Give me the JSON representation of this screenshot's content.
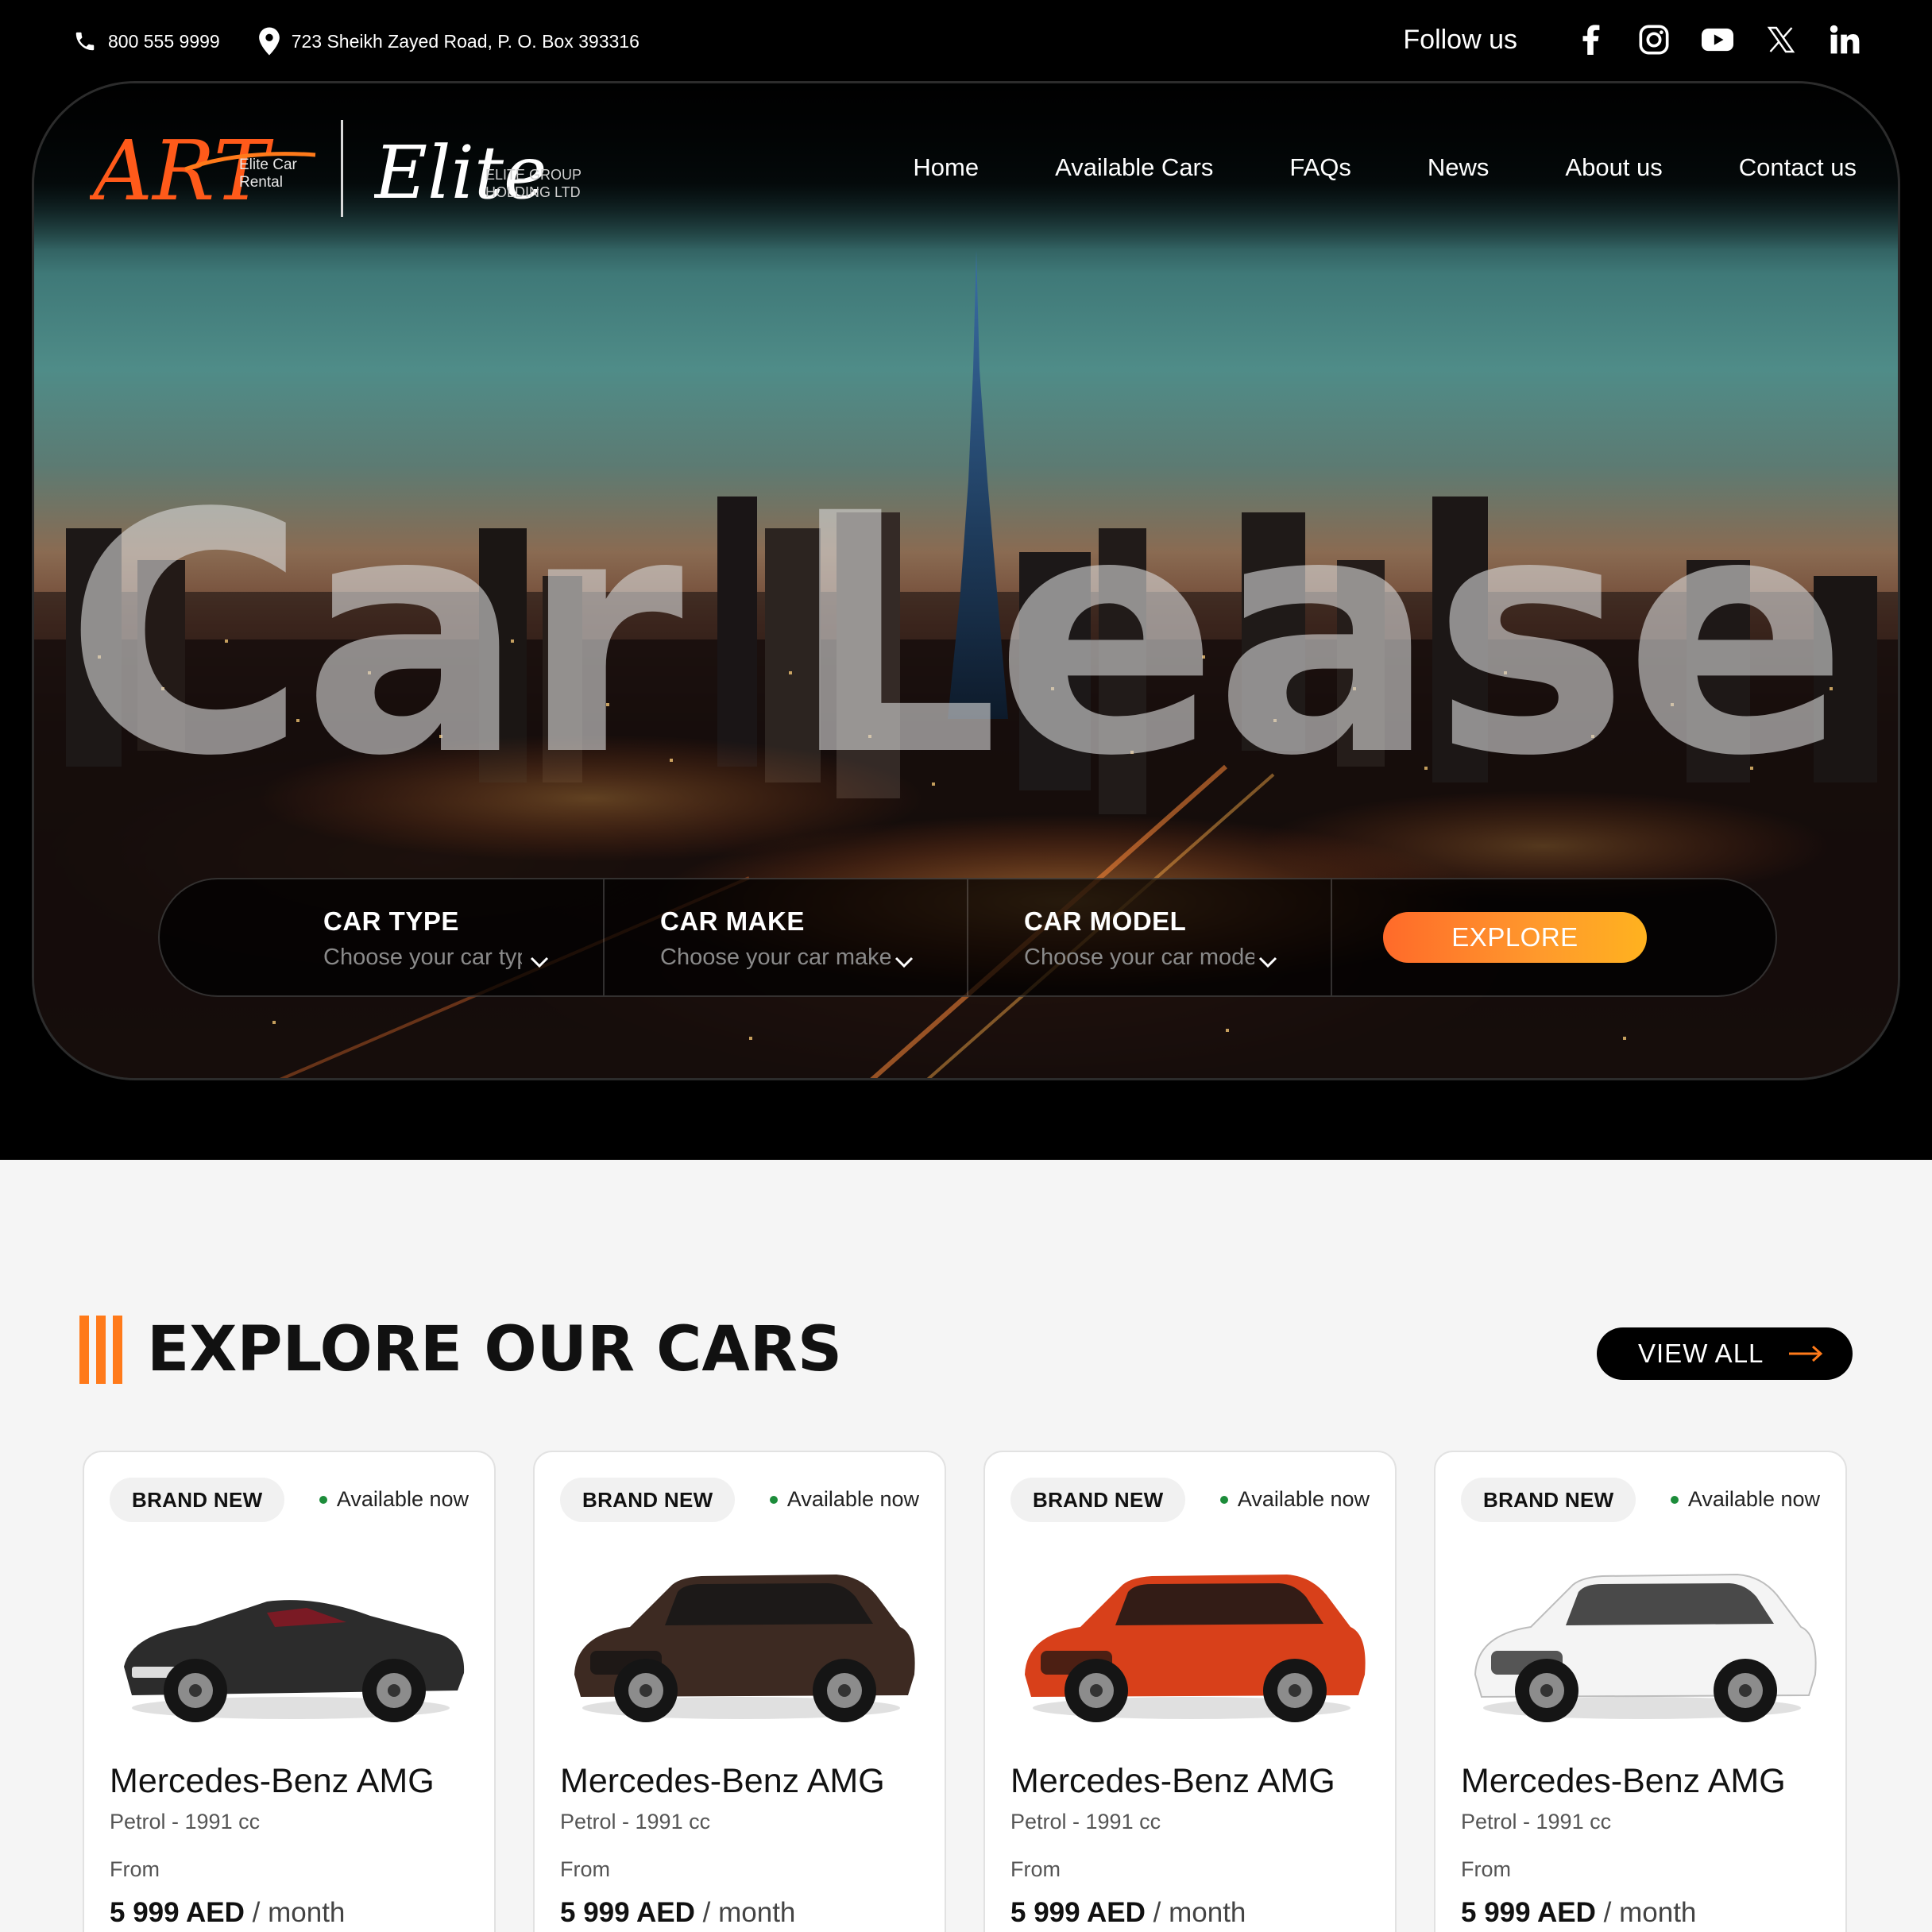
{
  "topbar": {
    "phone": "800 555 9999",
    "address": "723 Sheikh Zayed Road, P. O. Box 393316",
    "follow_label": "Follow us",
    "socials": [
      "facebook-icon",
      "instagram-icon",
      "youtube-icon",
      "x-icon",
      "linkedin-icon"
    ]
  },
  "logos": {
    "art_mark": "ART",
    "art_sub1": "Elite Car",
    "art_sub2": "Rental",
    "elite_mark": "Elite",
    "elite_sub1": "ELITE GROUP",
    "elite_sub2": "HOLDING LTD"
  },
  "nav": {
    "items": [
      "Home",
      "Available Cars",
      "FAQs",
      "News",
      "About us",
      "Contact us"
    ]
  },
  "hero": {
    "title": "Car Lease"
  },
  "search": {
    "fields": [
      {
        "label": "CAR TYPE",
        "placeholder": "Choose your car type"
      },
      {
        "label": "CAR MAKE",
        "placeholder": "Choose your car make"
      },
      {
        "label": "CAR MODEL",
        "placeholder": "Choose your car model"
      }
    ],
    "button": "EXPLORE"
  },
  "section": {
    "title": "EXPLORE OUR CARS",
    "view_all": "VIEW ALL"
  },
  "cards": [
    {
      "badge": "BRAND NEW",
      "status": "Available now",
      "name": "Mercedes-Benz AMG",
      "spec": "Petrol - 1991 cc",
      "from": "From",
      "price": "5 999 AED",
      "period": "/ month",
      "car_color": "#2c2c2c",
      "car_kind": "convertible"
    },
    {
      "badge": "BRAND NEW",
      "status": "Available now",
      "name": "Mercedes-Benz AMG",
      "spec": "Petrol - 1991 cc",
      "from": "From",
      "price": "5 999 AED",
      "period": "/ month",
      "car_color": "#3d2a22",
      "car_kind": "suv"
    },
    {
      "badge": "BRAND NEW",
      "status": "Available now",
      "name": "Mercedes-Benz AMG",
      "spec": "Petrol - 1991 cc",
      "from": "From",
      "price": "5 999 AED",
      "period": "/ month",
      "car_color": "#d8401a",
      "car_kind": "suv"
    },
    {
      "badge": "BRAND NEW",
      "status": "Available now",
      "name": "Mercedes-Benz AMG",
      "spec": "Petrol - 1991 cc",
      "from": "From",
      "price": "5 999 AED",
      "period": "/ month",
      "car_color": "#f4f4f4",
      "car_kind": "suv"
    }
  ],
  "colors": {
    "accent": "#ff7a1a",
    "available_dot": "#1c8c3a"
  }
}
